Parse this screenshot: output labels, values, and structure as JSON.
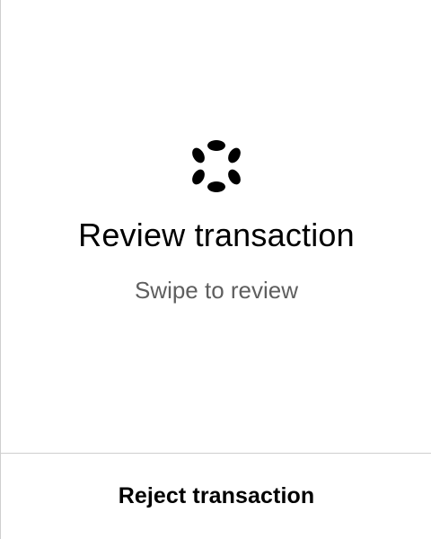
{
  "review": {
    "logo_icon": "polkadot-logo-icon",
    "title": "Review transaction",
    "subtitle": "Swipe to review"
  },
  "footer": {
    "reject_label": "Reject transaction"
  },
  "colors": {
    "background": "#ffffff",
    "text": "#000000",
    "secondary_text": "#5f5f5f",
    "divider": "#cfcfcf"
  }
}
